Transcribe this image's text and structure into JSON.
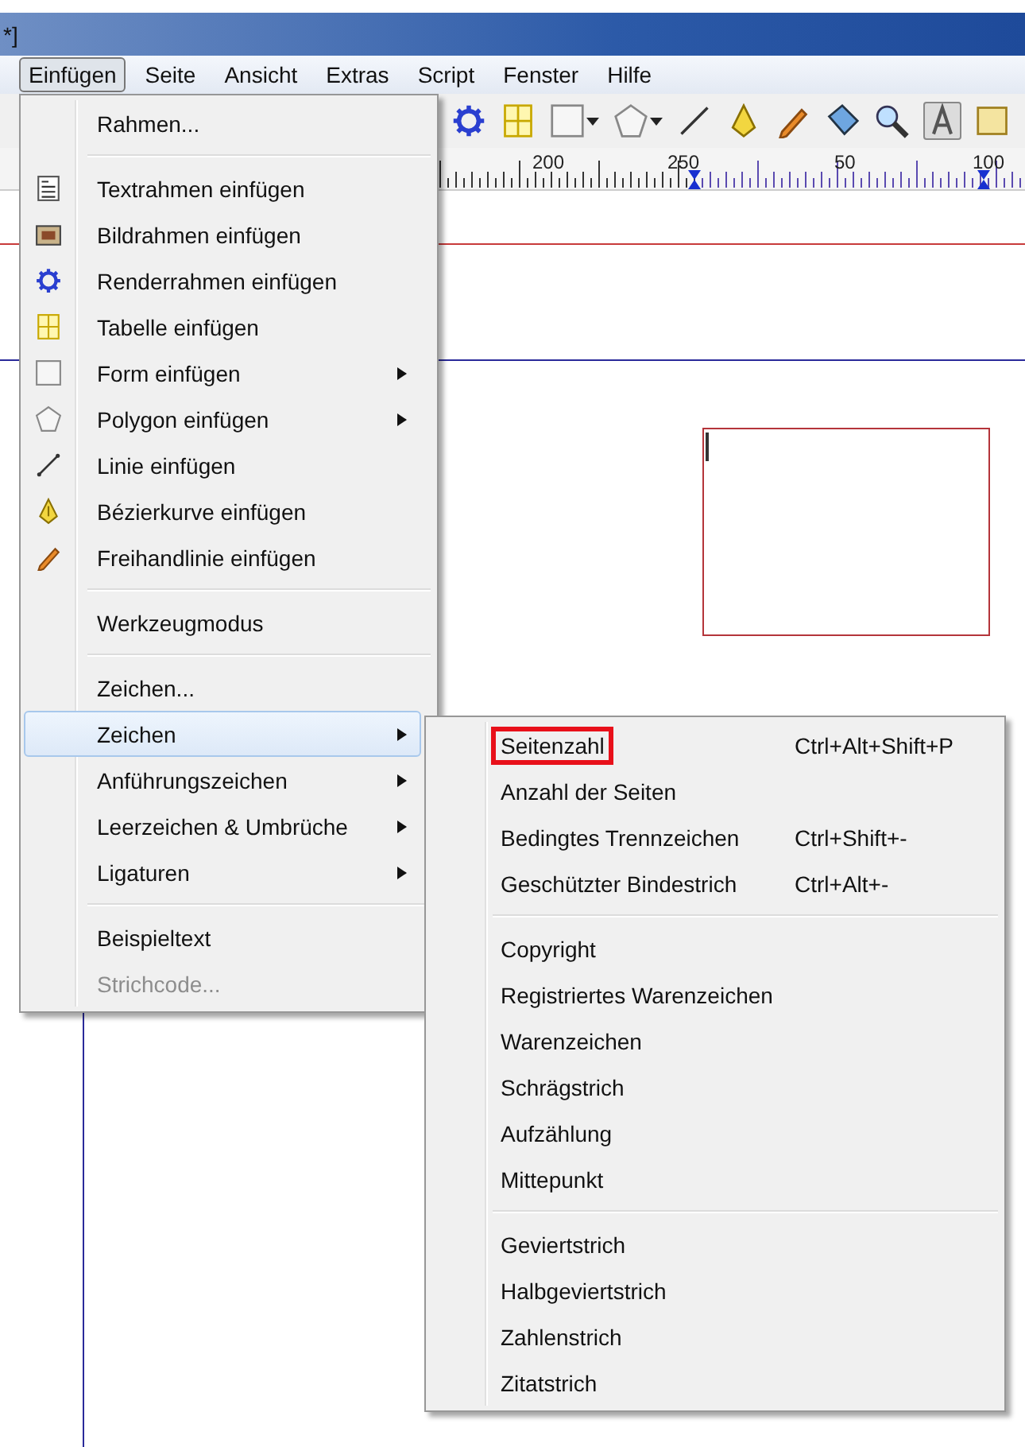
{
  "window": {
    "title": "*]"
  },
  "menubar": [
    {
      "label": "Einfügen",
      "selected": true
    },
    {
      "label": "Seite",
      "selected": false
    },
    {
      "label": "Ansicht",
      "selected": false
    },
    {
      "label": "Extras",
      "selected": false
    },
    {
      "label": "Script",
      "selected": false
    },
    {
      "label": "Fenster",
      "selected": false
    },
    {
      "label": "Hilfe",
      "selected": false
    }
  ],
  "ruler": {
    "labels": [
      "200",
      "250",
      "50",
      "100"
    ]
  },
  "menu": {
    "sections": [
      {
        "items": [
          {
            "label": "Rahmen...",
            "submenu": false,
            "disabled": false,
            "selected": false
          }
        ]
      },
      {
        "items": [
          {
            "label": "Textrahmen einfügen",
            "submenu": false,
            "disabled": false,
            "selected": false
          },
          {
            "label": "Bildrahmen einfügen",
            "submenu": false,
            "disabled": false,
            "selected": false
          },
          {
            "label": "Renderrahmen einfügen",
            "submenu": false,
            "disabled": false,
            "selected": false
          },
          {
            "label": "Tabelle einfügen",
            "submenu": false,
            "disabled": false,
            "selected": false
          },
          {
            "label": "Form einfügen",
            "submenu": true,
            "disabled": false,
            "selected": false
          },
          {
            "label": "Polygon einfügen",
            "submenu": true,
            "disabled": false,
            "selected": false
          },
          {
            "label": "Linie einfügen",
            "submenu": false,
            "disabled": false,
            "selected": false
          },
          {
            "label": "Bézierkurve einfügen",
            "submenu": false,
            "disabled": false,
            "selected": false
          },
          {
            "label": "Freihandlinie einfügen",
            "submenu": false,
            "disabled": false,
            "selected": false
          }
        ]
      },
      {
        "items": [
          {
            "label": "Werkzeugmodus",
            "submenu": false,
            "disabled": false,
            "selected": false
          }
        ]
      },
      {
        "items": [
          {
            "label": "Zeichen...",
            "submenu": false,
            "disabled": false,
            "selected": false
          },
          {
            "label": "Zeichen",
            "submenu": true,
            "disabled": false,
            "selected": true
          },
          {
            "label": "Anführungszeichen",
            "submenu": true,
            "disabled": false,
            "selected": false
          },
          {
            "label": "Leerzeichen & Umbrüche",
            "submenu": true,
            "disabled": false,
            "selected": false
          },
          {
            "label": "Ligaturen",
            "submenu": true,
            "disabled": false,
            "selected": false
          }
        ]
      },
      {
        "items": [
          {
            "label": "Beispieltext",
            "submenu": false,
            "disabled": false,
            "selected": false
          },
          {
            "label": "Strichcode...",
            "submenu": false,
            "disabled": true,
            "selected": false
          }
        ]
      }
    ]
  },
  "submenu": {
    "sections": [
      {
        "items": [
          {
            "label": "Seitenzahl",
            "shortcut": "Ctrl+Alt+Shift+P",
            "annotated": true,
            "selected": false
          },
          {
            "label": "Anzahl der Seiten",
            "annotated": false,
            "selected": false
          },
          {
            "label": "Bedingtes Trennzeichen",
            "shortcut": "Ctrl+Shift+-",
            "annotated": false,
            "selected": false
          },
          {
            "label": "Geschützter Bindestrich",
            "shortcut": "Ctrl+Alt+-",
            "annotated": false,
            "selected": false
          }
        ]
      },
      {
        "items": [
          {
            "label": "Copyright",
            "annotated": false,
            "selected": false
          },
          {
            "label": "Registriertes Warenzeichen",
            "annotated": false,
            "selected": false
          },
          {
            "label": "Warenzeichen",
            "annotated": false,
            "selected": false
          },
          {
            "label": "Schrägstrich",
            "annotated": false,
            "selected": false
          },
          {
            "label": "Aufzählung",
            "annotated": false,
            "selected": false
          },
          {
            "label": "Mittepunkt",
            "annotated": false,
            "selected": false
          }
        ]
      },
      {
        "items": [
          {
            "label": "Geviertstrich",
            "annotated": false,
            "selected": false
          },
          {
            "label": "Halbgeviertstrich",
            "annotated": false,
            "selected": false
          },
          {
            "label": "Zahlenstrich",
            "annotated": false,
            "selected": false
          },
          {
            "label": "Zitatstrich",
            "annotated": false,
            "selected": false
          }
        ]
      }
    ]
  }
}
